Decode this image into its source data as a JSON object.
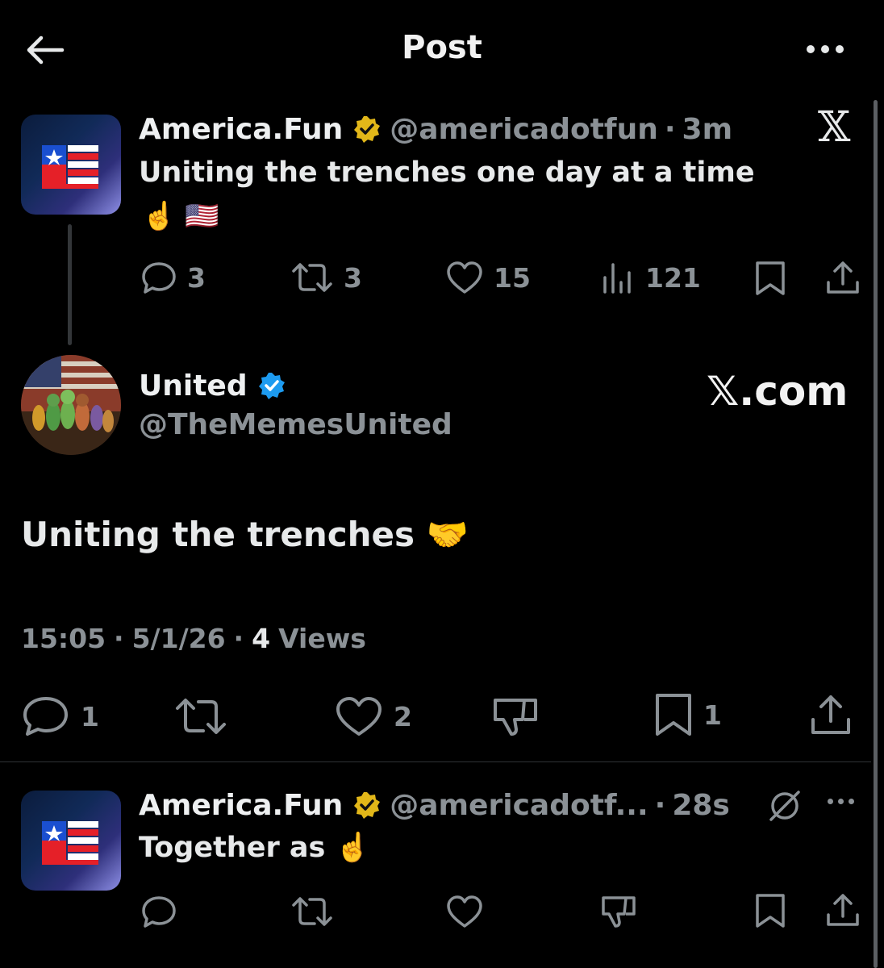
{
  "header": {
    "title": "Post"
  },
  "parent_tweet": {
    "name": "America.Fun",
    "handle": "@americadotfun",
    "sep": "·",
    "time": "3m",
    "text": "Uniting the trenches one day at a time",
    "emoji_line": "☝️ 🇺🇸",
    "stats": {
      "replies": "3",
      "reposts": "3",
      "likes": "15",
      "views": "121"
    },
    "source_logo": "𝕏"
  },
  "main_tweet": {
    "name": "United",
    "handle": "@TheMemesUnited",
    "source_label": "𝕏.com",
    "text": "Uniting the trenches 🤝",
    "time": "15:05",
    "date": "5/1/26",
    "views_count": "4",
    "views_label": "Views",
    "sep": "·",
    "stats": {
      "replies": "1",
      "likes": "2",
      "bookmarks": "1"
    }
  },
  "reply_tweet": {
    "name": "America.Fun",
    "handle": "@americadotf...",
    "sep": "·",
    "time": "28s",
    "text": "Together as ☝️"
  },
  "colors": {
    "background": "#000000",
    "muted": "#8b9196",
    "verified_gold": "#e2b719",
    "verified_blue": "#1d9bf0"
  }
}
